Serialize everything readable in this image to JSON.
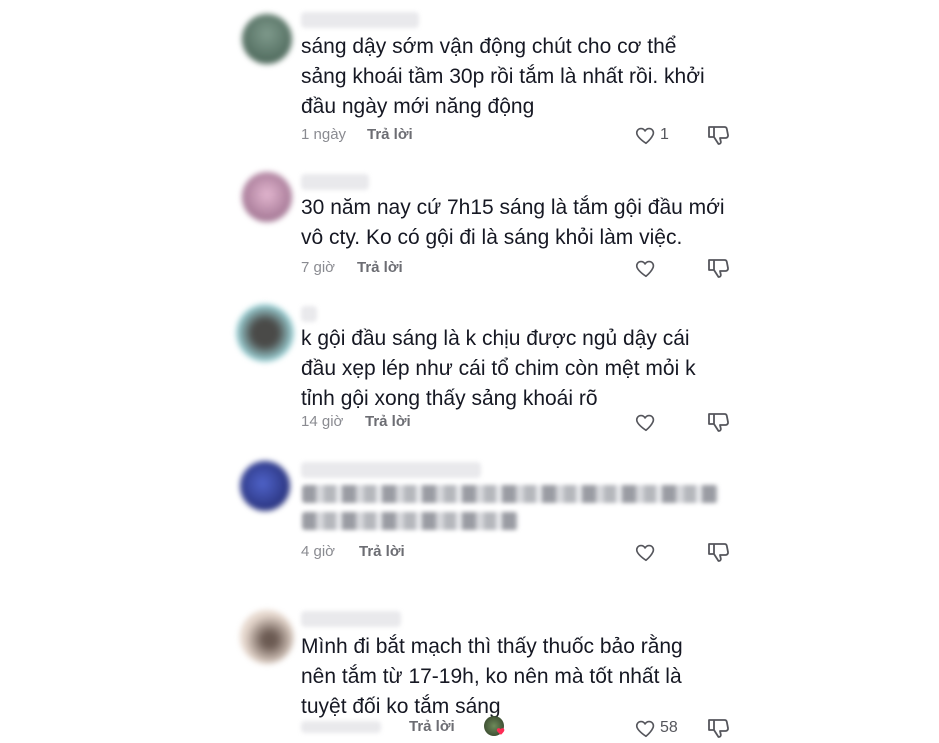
{
  "comments": [
    {
      "text": "sáng dậy sớm vận động chút cho cơ thể\nsảng khoái tầm 30p rồi tắm là nhất rồi. khởi\nđầu ngày mới năng động",
      "time": "1 ngày",
      "reply": "Trả lời",
      "likes": "1",
      "avatar_color": "#4e6b5e"
    },
    {
      "text": "30 năm nay cứ 7h15 sáng là tắm gội đầu mới\nvô cty. Ko có gội đi là sáng khỏi làm việc.",
      "time": "7 giờ",
      "reply": "Trả lời",
      "likes": "",
      "avatar_color": "#b38aa8"
    },
    {
      "text": "k gội đầu sáng là k chịu được ngủ dậy cái\nđầu xẹp lép như cái tổ chim còn mệt mỏi k\ntỉnh gội xong thấy sảng khoái rõ",
      "time": "14 giờ",
      "reply": "Trả lời",
      "likes": "",
      "avatar_color": "#6f8a8c"
    },
    {
      "text": "",
      "time": "4 giờ",
      "reply": "Trả lời",
      "likes": "",
      "avatar_color": "#2f3f8f"
    },
    {
      "text": "Mình đi bắt mạch thì thấy thuốc bảo rằng\nnên tắm từ 17-19h, ko nên mà tốt nhất là\ntuyệt đối ko tắm sáng",
      "time": "",
      "reply": "Trả lời",
      "likes": "58",
      "avatar_color": "#c9b3a6"
    }
  ],
  "icons": {
    "like": "heart-outline-icon",
    "dislike": "thumbs-down-icon"
  }
}
